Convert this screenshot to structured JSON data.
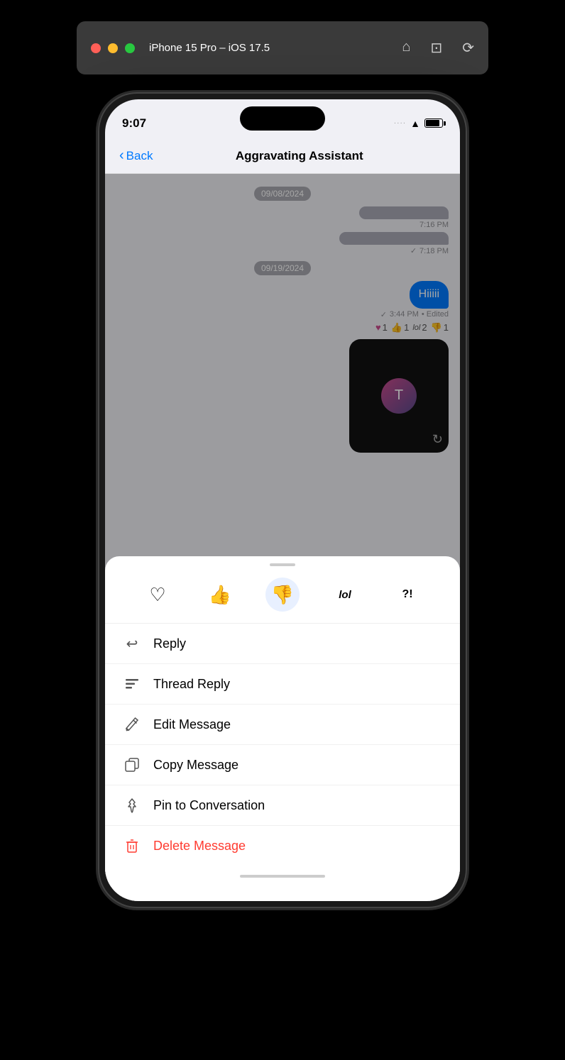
{
  "titleBar": {
    "title": "iPhone 15 Pro – iOS 17.5",
    "icons": [
      "home",
      "screenshot",
      "rotate"
    ]
  },
  "statusBar": {
    "time": "9:07",
    "dots": "····",
    "wifi": "WiFi",
    "battery": "Battery"
  },
  "navBar": {
    "backLabel": "Back",
    "title": "Aggravating Assistant"
  },
  "chat": {
    "date1": "09/08/2024",
    "time1": "7:16 PM",
    "time2": "7:18 PM",
    "date2": "09/19/2024",
    "msg1": "Hiiiii",
    "msgTime1": "3:44 PM",
    "msgEdited": "• Edited"
  },
  "reactions": {
    "heart": "♥",
    "heartCount": "1",
    "thumbsUp": "👍",
    "thumbsUpCount": "1",
    "lol": "lol",
    "lolCount": "2",
    "thumbsDown": "👎",
    "thumbsDownCount": "1"
  },
  "reactionPicker": {
    "heart": "♡",
    "thumbsUp": "👍",
    "thumbsDown": "👎",
    "lol": "lol",
    "emphasis": "?!"
  },
  "menu": {
    "items": [
      {
        "id": "reply",
        "icon": "↩",
        "label": "Reply"
      },
      {
        "id": "thread-reply",
        "icon": "≡",
        "label": "Thread Reply"
      },
      {
        "id": "edit",
        "icon": "✎",
        "label": "Edit Message"
      },
      {
        "id": "copy",
        "icon": "⧉",
        "label": "Copy Message"
      },
      {
        "id": "pin",
        "icon": "⌀",
        "label": "Pin to Conversation"
      },
      {
        "id": "delete",
        "icon": "🗑",
        "label": "Delete Message",
        "danger": true
      }
    ]
  }
}
